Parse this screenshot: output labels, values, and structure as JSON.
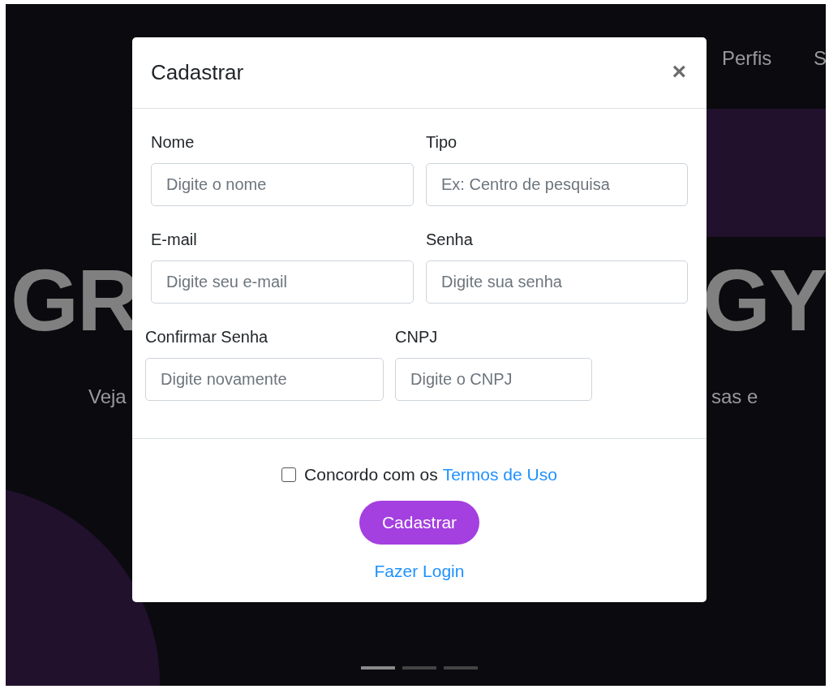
{
  "background": {
    "nav_items": [
      "Perfis",
      "S"
    ],
    "headline_left": "GR",
    "headline_right": "GY",
    "subtitle_left": "Veja",
    "subtitle_right": "sas e",
    "carousel_indicators": [
      {
        "selected": true
      },
      {
        "selected": false
      },
      {
        "selected": false
      }
    ]
  },
  "modal": {
    "title": "Cadastrar",
    "close": "×",
    "rows": [
      [
        {
          "label": "Nome",
          "placeholder": "Digite o nome"
        },
        {
          "label": "Tipo",
          "placeholder": "Ex: Centro de pesquisa"
        }
      ],
      [
        {
          "label": "E-mail",
          "placeholder": "Digite seu e-mail"
        },
        {
          "label": "Senha",
          "placeholder": "Digite sua senha"
        }
      ],
      [
        {
          "label": "Confirmar Senha",
          "placeholder": "Digite novamente"
        },
        {
          "label": "CNPJ",
          "placeholder": "Digite o CNPJ"
        }
      ]
    ],
    "terms": {
      "checked": false,
      "text": "Concordo com os",
      "link": "Termos de Uso"
    },
    "submit": "Cadastrar",
    "login_link": "Fazer Login"
  }
}
